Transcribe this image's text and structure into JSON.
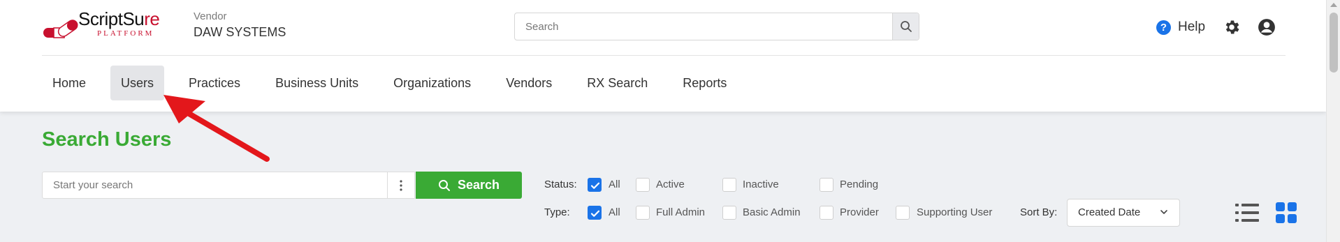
{
  "header": {
    "logo": {
      "brand": "ScriptSure",
      "rx_mark": "Rx",
      "sub": "PLATFORM"
    },
    "vendor_label": "Vendor",
    "vendor_name": "DAW SYSTEMS",
    "search": {
      "placeholder": "Search",
      "icon": "search-icon"
    },
    "help_label": "Help",
    "icons": [
      "help-icon",
      "gear-icon",
      "account-icon"
    ]
  },
  "nav": {
    "items": [
      {
        "label": "Home"
      },
      {
        "label": "Users",
        "active": true
      },
      {
        "label": "Practices"
      },
      {
        "label": "Business Units"
      },
      {
        "label": "Organizations"
      },
      {
        "label": "Vendors"
      },
      {
        "label": "RX Search"
      },
      {
        "label": "Reports"
      }
    ]
  },
  "page": {
    "title": "Search Users",
    "search_placeholder": "Start your search",
    "search_button": "Search",
    "status": {
      "label": "Status:",
      "options": [
        {
          "label": "All",
          "checked": true
        },
        {
          "label": "Active",
          "checked": false
        },
        {
          "label": "Inactive",
          "checked": false
        },
        {
          "label": "Pending",
          "checked": false
        }
      ]
    },
    "type": {
      "label": "Type:",
      "options": [
        {
          "label": "All",
          "checked": true
        },
        {
          "label": "Full Admin",
          "checked": false
        },
        {
          "label": "Basic Admin",
          "checked": false
        },
        {
          "label": "Provider",
          "checked": false
        },
        {
          "label": "Supporting User",
          "checked": false
        }
      ]
    },
    "sort": {
      "label": "Sort By:",
      "value": "Created Date"
    },
    "view_icons": [
      "list-view-icon",
      "grid-view-icon"
    ]
  },
  "colors": {
    "brand_green": "#3aaa35",
    "accent_blue": "#1a73e8",
    "annotation_red": "#e3171b",
    "logo_red": "#c8102e"
  }
}
